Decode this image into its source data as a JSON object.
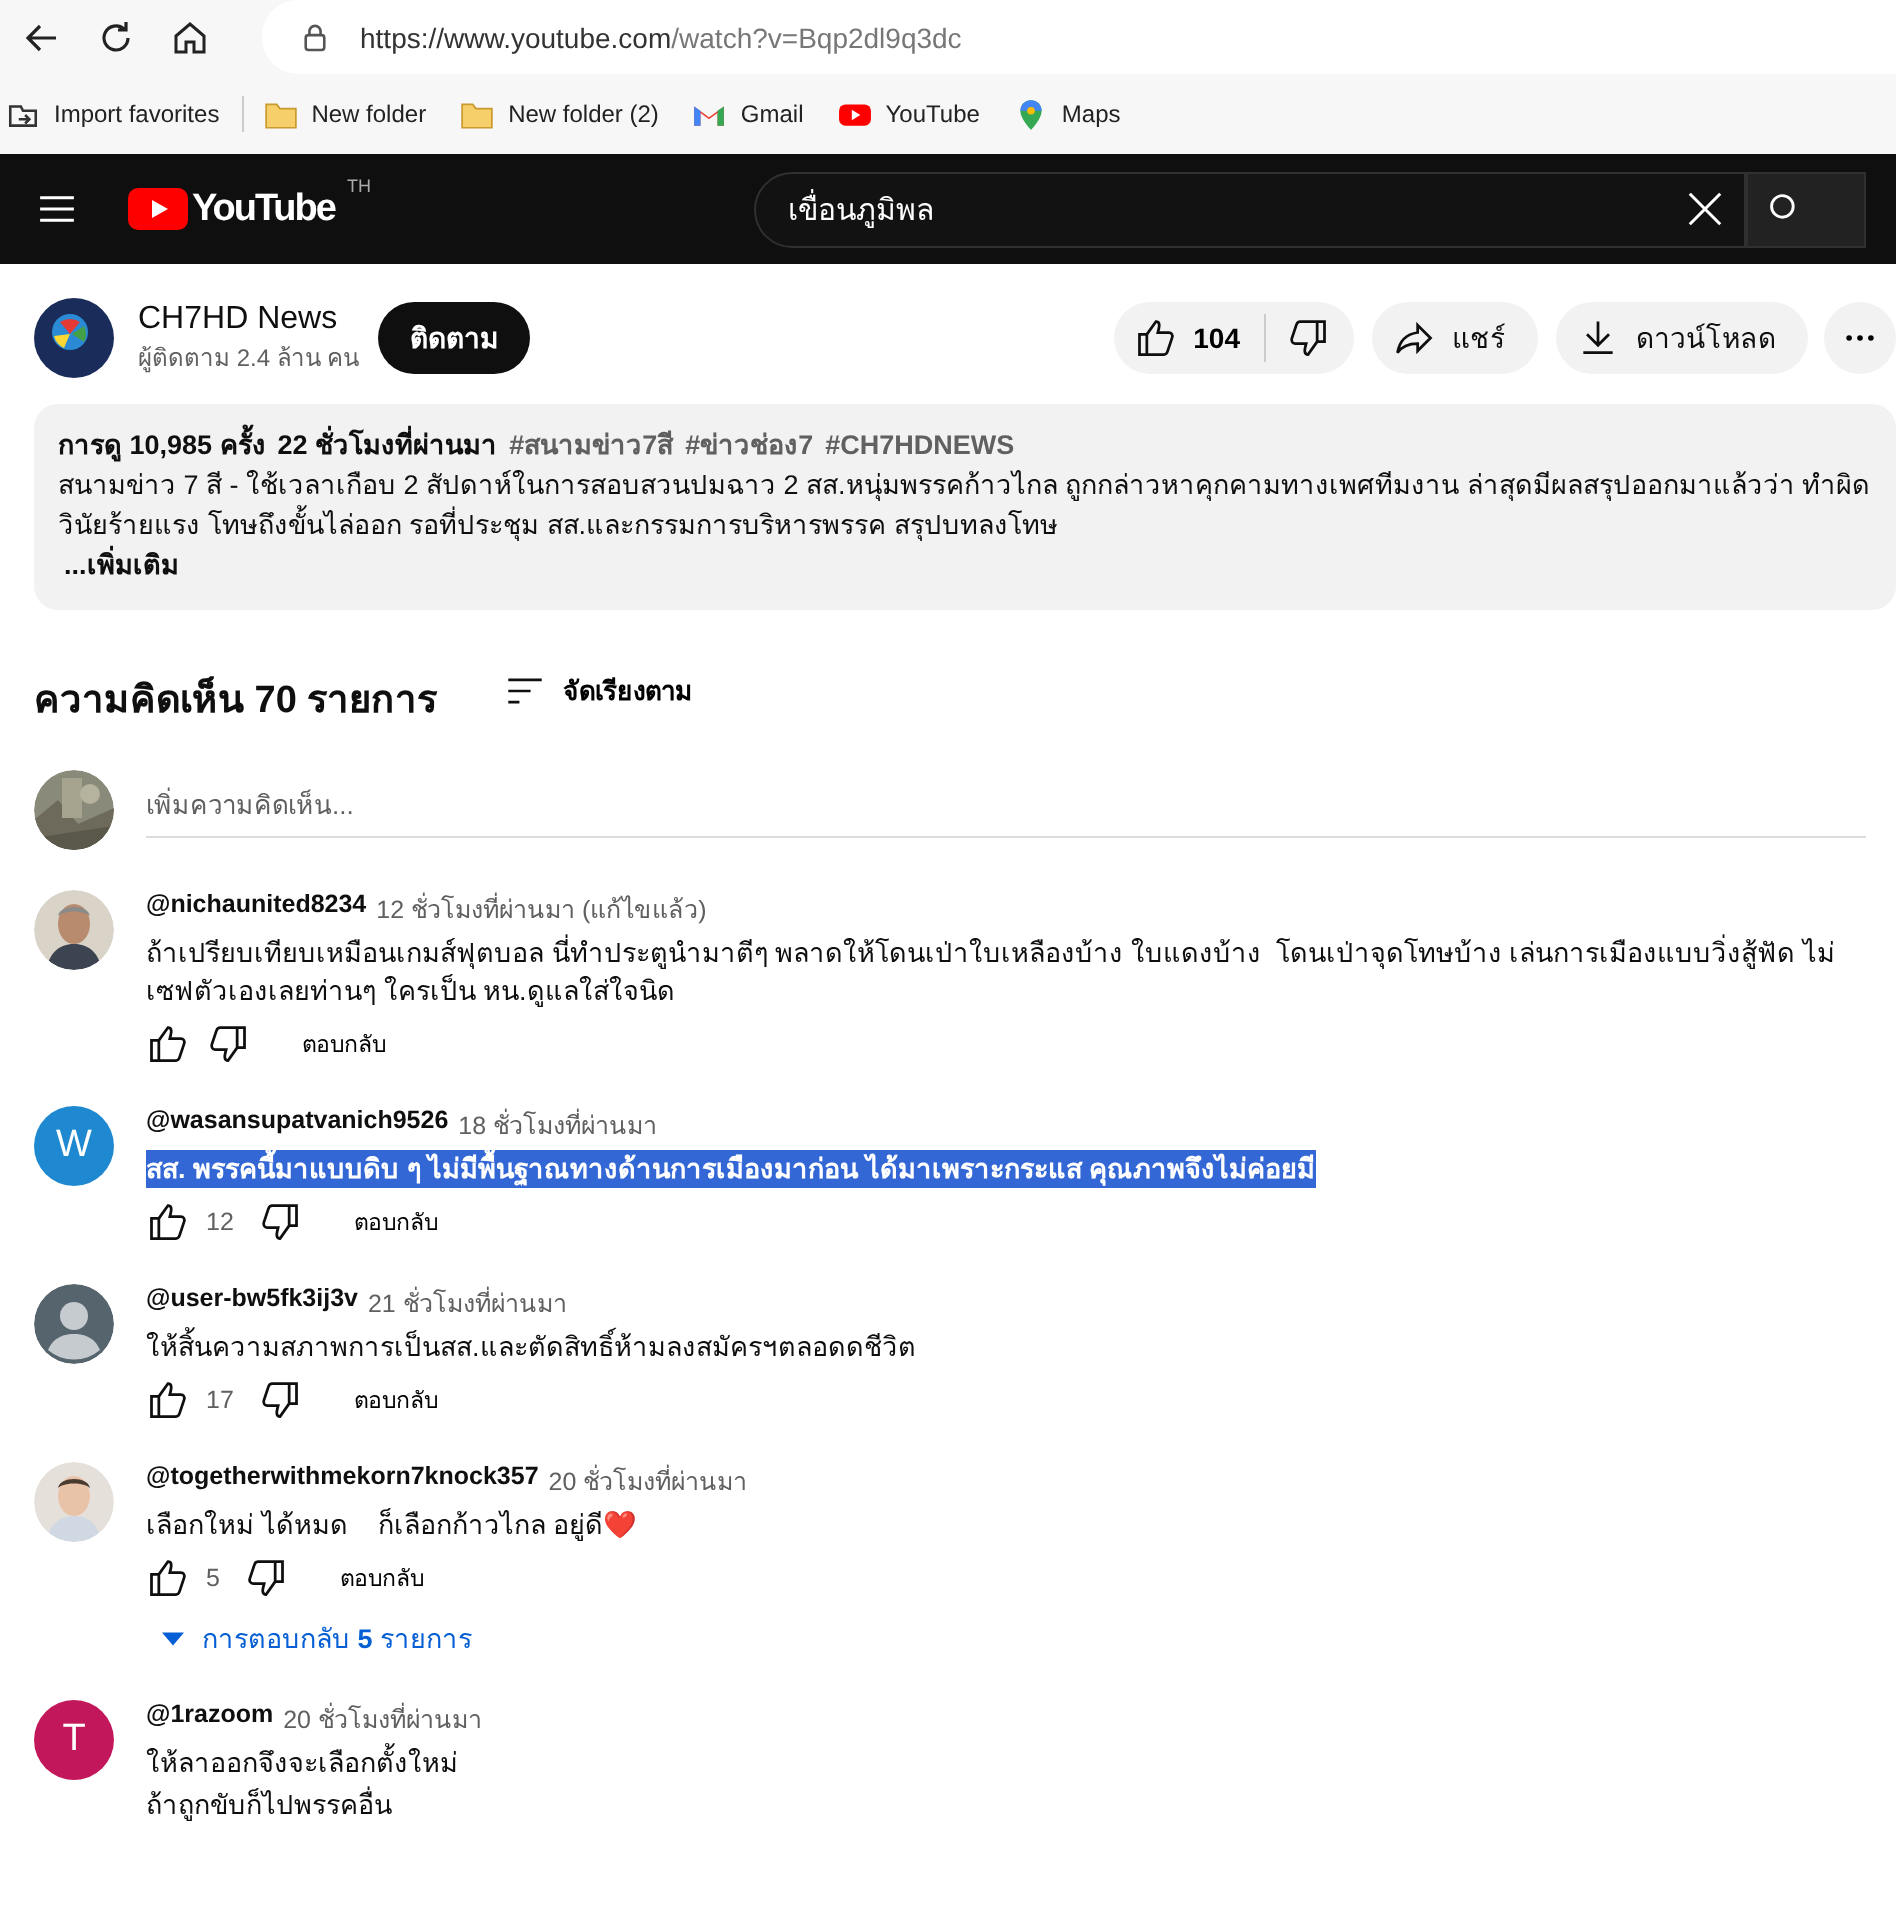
{
  "browser": {
    "url_host": "https://www.youtube.com",
    "url_path": "/watch?v=Bqp2dl9q3dc"
  },
  "bookmarks": [
    {
      "label": "Import favorites",
      "kind": "import"
    },
    {
      "label": "New folder",
      "kind": "folder"
    },
    {
      "label": "New folder (2)",
      "kind": "folder"
    },
    {
      "label": "Gmail",
      "kind": "gmail"
    },
    {
      "label": "YouTube",
      "kind": "youtube"
    },
    {
      "label": "Maps",
      "kind": "maps"
    }
  ],
  "header": {
    "logo": "YouTube",
    "region": "TH",
    "search": "เขื่อนภูมิพล"
  },
  "channel": {
    "name": "CH7HD News",
    "subscribers": "ผู้ติดตาม 2.4 ล้าน คน",
    "subscribe": "ติดตาม"
  },
  "actions": {
    "likes": "104",
    "share": "แชร์",
    "download": "ดาวน์โหลด"
  },
  "description": {
    "views": "การดู 10,985 ครั้ง",
    "age": "22 ชั่วโมงที่ผ่านมา",
    "hashtags": [
      "#สนามข่าว7สี",
      "#ข่าวช่อง7",
      "#CH7HDNEWS"
    ],
    "lines": [
      "สนามข่าว 7 สี - ใช้เวลาเกือบ 2 สัปดาห์ในการสอบสวนปมฉาว 2 สส.หนุ่มพรรคก้าวไกล ถูกกล่าวหาคุกคามทางเพศทีมงาน ล่าสุดมีผลสรุปออกมาแล้วว่า ทำผิดวินัยร้ายแรง โทษถึงขั้นไล่ออก รอที่ประชุม สส.และกรรมการบริหารพรรค สรุปบทลงโทษ"
    ],
    "more": "...เพิ่มเติม"
  },
  "comments_header": {
    "title": "ความคิดเห็น 70 รายการ",
    "sort": "จัดเรียงตาม"
  },
  "add_comment": {
    "placeholder": "เพิ่มความคิดเห็น..."
  },
  "comments": [
    {
      "author": "@nichaunited8234",
      "time": "12 ชั่วโมงที่ผ่านมา (แก้ไขแล้ว)",
      "avatar": {
        "kind": "picture"
      },
      "text": [
        "ถ้าเปรียบเทียบเหมือนเกมส์ฟุตบอล นี่ทำประตูนำมาตีๆ พลาดให้โดนเป่าใบเหลืองบ้าง ใบแดงบ้าง  โดนเป่าจุดโทษบ้าง เล่นการเมืองแบบวิ่งสู้ฟัด ไม่เซฟตัวเองเลยท่านๆ ใครเป็น หน.ดูแลใส่ใจนิด"
      ],
      "highlighted": false,
      "reply": "ตอบกลับ"
    },
    {
      "author": "@wasansupatvanich9526",
      "time": "18 ชั่วโมงที่ผ่านมา",
      "avatar": {
        "kind": "letter",
        "letter": "W",
        "color": "#1e88d0"
      },
      "text": [
        "สส. พรรคนี้มาแบบดิบ ๆ ไม่มีพื้นฐาณทางด้านการเมืองมาก่อน ได้มาเพราะกระแส คุณภาพจึงไม่ค่อยมี"
      ],
      "highlighted": true,
      "likes": "12",
      "reply": "ตอบกลับ"
    },
    {
      "author": "@user-bw5fk3ij3v",
      "time": "21 ชั่วโมงที่ผ่านมา",
      "avatar": {
        "kind": "default"
      },
      "text": [
        "ให้สิ้นความสภาพการเป็นสส.และตัดสิทธิ์ห้ามลงสมัครฯตลอดดชีวิต"
      ],
      "highlighted": false,
      "likes": "17",
      "reply": "ตอบกลับ"
    },
    {
      "author": "@togetherwithmekorn7knock357",
      "time": "20 ชั่วโมงที่ผ่านมา",
      "avatar": {
        "kind": "picture"
      },
      "text": [
        "เลือกใหม่ ได้หมด    ก็เลือกก้าวไกล อยู่ดี❤️"
      ],
      "highlighted": false,
      "likes": "5",
      "reply": "ตอบกลับ",
      "replies": "การตอบกลับ **5** รายการ"
    },
    {
      "author": "@1razoom",
      "time": "20 ชั่วโมงที่ผ่านมา",
      "avatar": {
        "kind": "letter",
        "letter": "T",
        "color": "#c2185b"
      },
      "text": [
        "ให้ลาออกจึงจะเลือกตั้งใหม่",
        "ถ้าถูกขับก็ไปพรรคอื่น"
      ],
      "highlighted": false
    }
  ]
}
